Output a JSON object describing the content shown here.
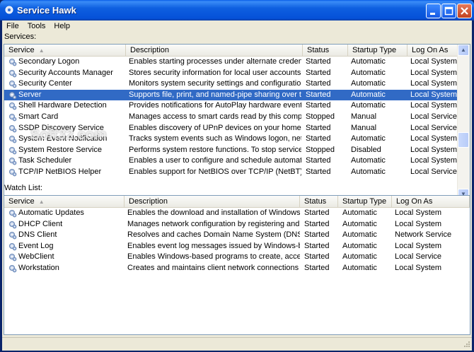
{
  "window": {
    "title": "Service Hawk"
  },
  "menu": [
    {
      "label": "File"
    },
    {
      "label": "Tools"
    },
    {
      "label": "Help"
    }
  ],
  "services": {
    "label": "Services:",
    "columns": {
      "service": "Service",
      "description": "Description",
      "status": "Status",
      "startup": "Startup Type",
      "logon": "Log On As"
    },
    "rows": [
      {
        "name": "Secondary Logon",
        "description": "Enables starting processes under alternate creden...",
        "status": "Started",
        "startup": "Automatic",
        "logon": "Local System"
      },
      {
        "name": "Security Accounts Manager",
        "description": "Stores security information for local user accounts.",
        "status": "Started",
        "startup": "Automatic",
        "logon": "Local System"
      },
      {
        "name": "Security Center",
        "description": "Monitors system security settings and configurations.",
        "status": "Started",
        "startup": "Automatic",
        "logon": "Local System"
      },
      {
        "name": "Server",
        "description": "Supports file, print, and named-pipe sharing over t...",
        "status": "Started",
        "startup": "Automatic",
        "logon": "Local System",
        "selected": true
      },
      {
        "name": "Shell Hardware Detection",
        "description": "Provides notifications for AutoPlay hardware events.",
        "status": "Started",
        "startup": "Automatic",
        "logon": "Local System"
      },
      {
        "name": "Smart Card",
        "description": "Manages access to smart cards read by this compu...",
        "status": "Stopped",
        "startup": "Manual",
        "logon": "Local Service"
      },
      {
        "name": "SSDP Discovery Service",
        "description": "Enables discovery of UPnP devices on your home n...",
        "status": "Started",
        "startup": "Manual",
        "logon": "Local Service"
      },
      {
        "name": "System Event Notification",
        "description": "Tracks system events such as Windows logon, net...",
        "status": "Started",
        "startup": "Automatic",
        "logon": "Local System"
      },
      {
        "name": "System Restore Service",
        "description": "Performs system restore functions. To stop service...",
        "status": "Stopped",
        "startup": "Disabled",
        "logon": "Local System"
      },
      {
        "name": "Task Scheduler",
        "description": "Enables a user to configure and schedule automat...",
        "status": "Started",
        "startup": "Automatic",
        "logon": "Local System"
      },
      {
        "name": "TCP/IP NetBIOS Helper",
        "description": "Enables support for NetBIOS over TCP/IP (NetBT) ...",
        "status": "Started",
        "startup": "Automatic",
        "logon": "Local Service"
      }
    ]
  },
  "watchlist": {
    "label": "Watch List:",
    "columns": {
      "service": "Service",
      "description": "Description",
      "status": "Status",
      "startup": "Startup Type",
      "logon": "Log On As"
    },
    "rows": [
      {
        "name": "Automatic Updates",
        "description": "Enables the download and installation of Windows ...",
        "status": "Started",
        "startup": "Automatic",
        "logon": "Local System"
      },
      {
        "name": "DHCP Client",
        "description": "Manages network configuration by registering and ...",
        "status": "Started",
        "startup": "Automatic",
        "logon": "Local System"
      },
      {
        "name": "DNS Client",
        "description": "Resolves and caches Domain Name System (DNS) ...",
        "status": "Started",
        "startup": "Automatic",
        "logon": "Network Service"
      },
      {
        "name": "Event Log",
        "description": "Enables event log messages issued by Windows-ba...",
        "status": "Started",
        "startup": "Automatic",
        "logon": "Local System"
      },
      {
        "name": "WebClient",
        "description": "Enables Windows-based programs to create, acces...",
        "status": "Started",
        "startup": "Automatic",
        "logon": "Local Service"
      },
      {
        "name": "Workstation",
        "description": "Creates and maintains client network connections t...",
        "status": "Started",
        "startup": "Automatic",
        "logon": "Local System"
      }
    ]
  },
  "watermark": "Soft32.com",
  "colors": {
    "selection": "#316ac5",
    "title_blue": "#0551d8"
  }
}
